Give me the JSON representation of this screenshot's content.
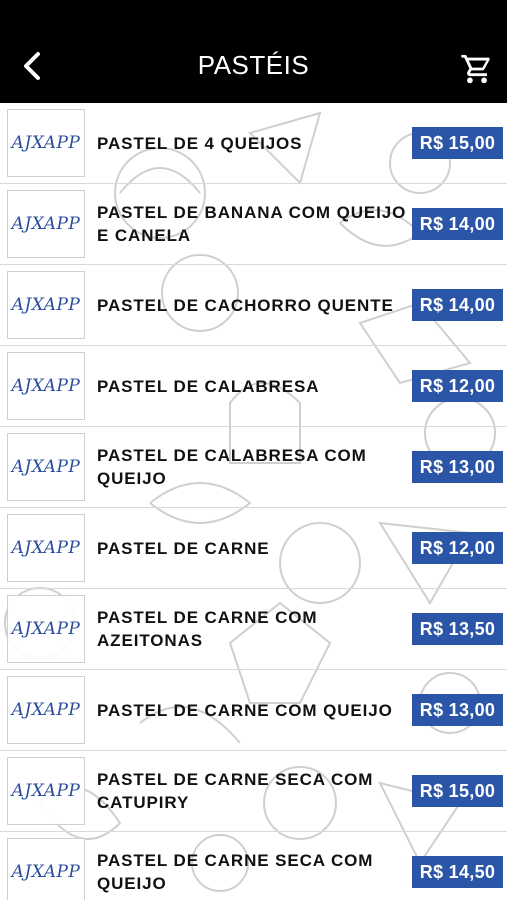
{
  "header": {
    "title": "PASTÉIS",
    "back_icon": "chevron-left-icon",
    "cart_icon": "cart-icon"
  },
  "theme": {
    "header_bg": "#000000",
    "price_bg": "#2b56a8",
    "logo_color": "#2a4d9c"
  },
  "items": [
    {
      "logo": "AJXAPP",
      "name": "PASTEL DE 4 QUEIJOS",
      "price": "R$ 15,00"
    },
    {
      "logo": "AJXAPP",
      "name": "PASTEL DE BANANA COM QUEIJO E CANELA",
      "price": "R$ 14,00"
    },
    {
      "logo": "AJXAPP",
      "name": "PASTEL DE CACHORRO QUENTE",
      "price": "R$ 14,00"
    },
    {
      "logo": "AJXAPP",
      "name": "PASTEL DE CALABRESA",
      "price": "R$ 12,00"
    },
    {
      "logo": "AJXAPP",
      "name": "PASTEL DE CALABRESA COM QUEIJO",
      "price": "R$ 13,00"
    },
    {
      "logo": "AJXAPP",
      "name": "PASTEL DE CARNE",
      "price": "R$ 12,00"
    },
    {
      "logo": "AJXAPP",
      "name": "PASTEL DE CARNE COM AZEITONAS",
      "price": "R$ 13,50"
    },
    {
      "logo": "AJXAPP",
      "name": "PASTEL DE CARNE COM QUEIJO",
      "price": "R$ 13,00"
    },
    {
      "logo": "AJXAPP",
      "name": "PASTEL DE CARNE SECA COM CATUPIRY",
      "price": "R$ 15,00"
    },
    {
      "logo": "AJXAPP",
      "name": "PASTEL DE CARNE SECA COM QUEIJO",
      "price": "R$ 14,50"
    }
  ]
}
